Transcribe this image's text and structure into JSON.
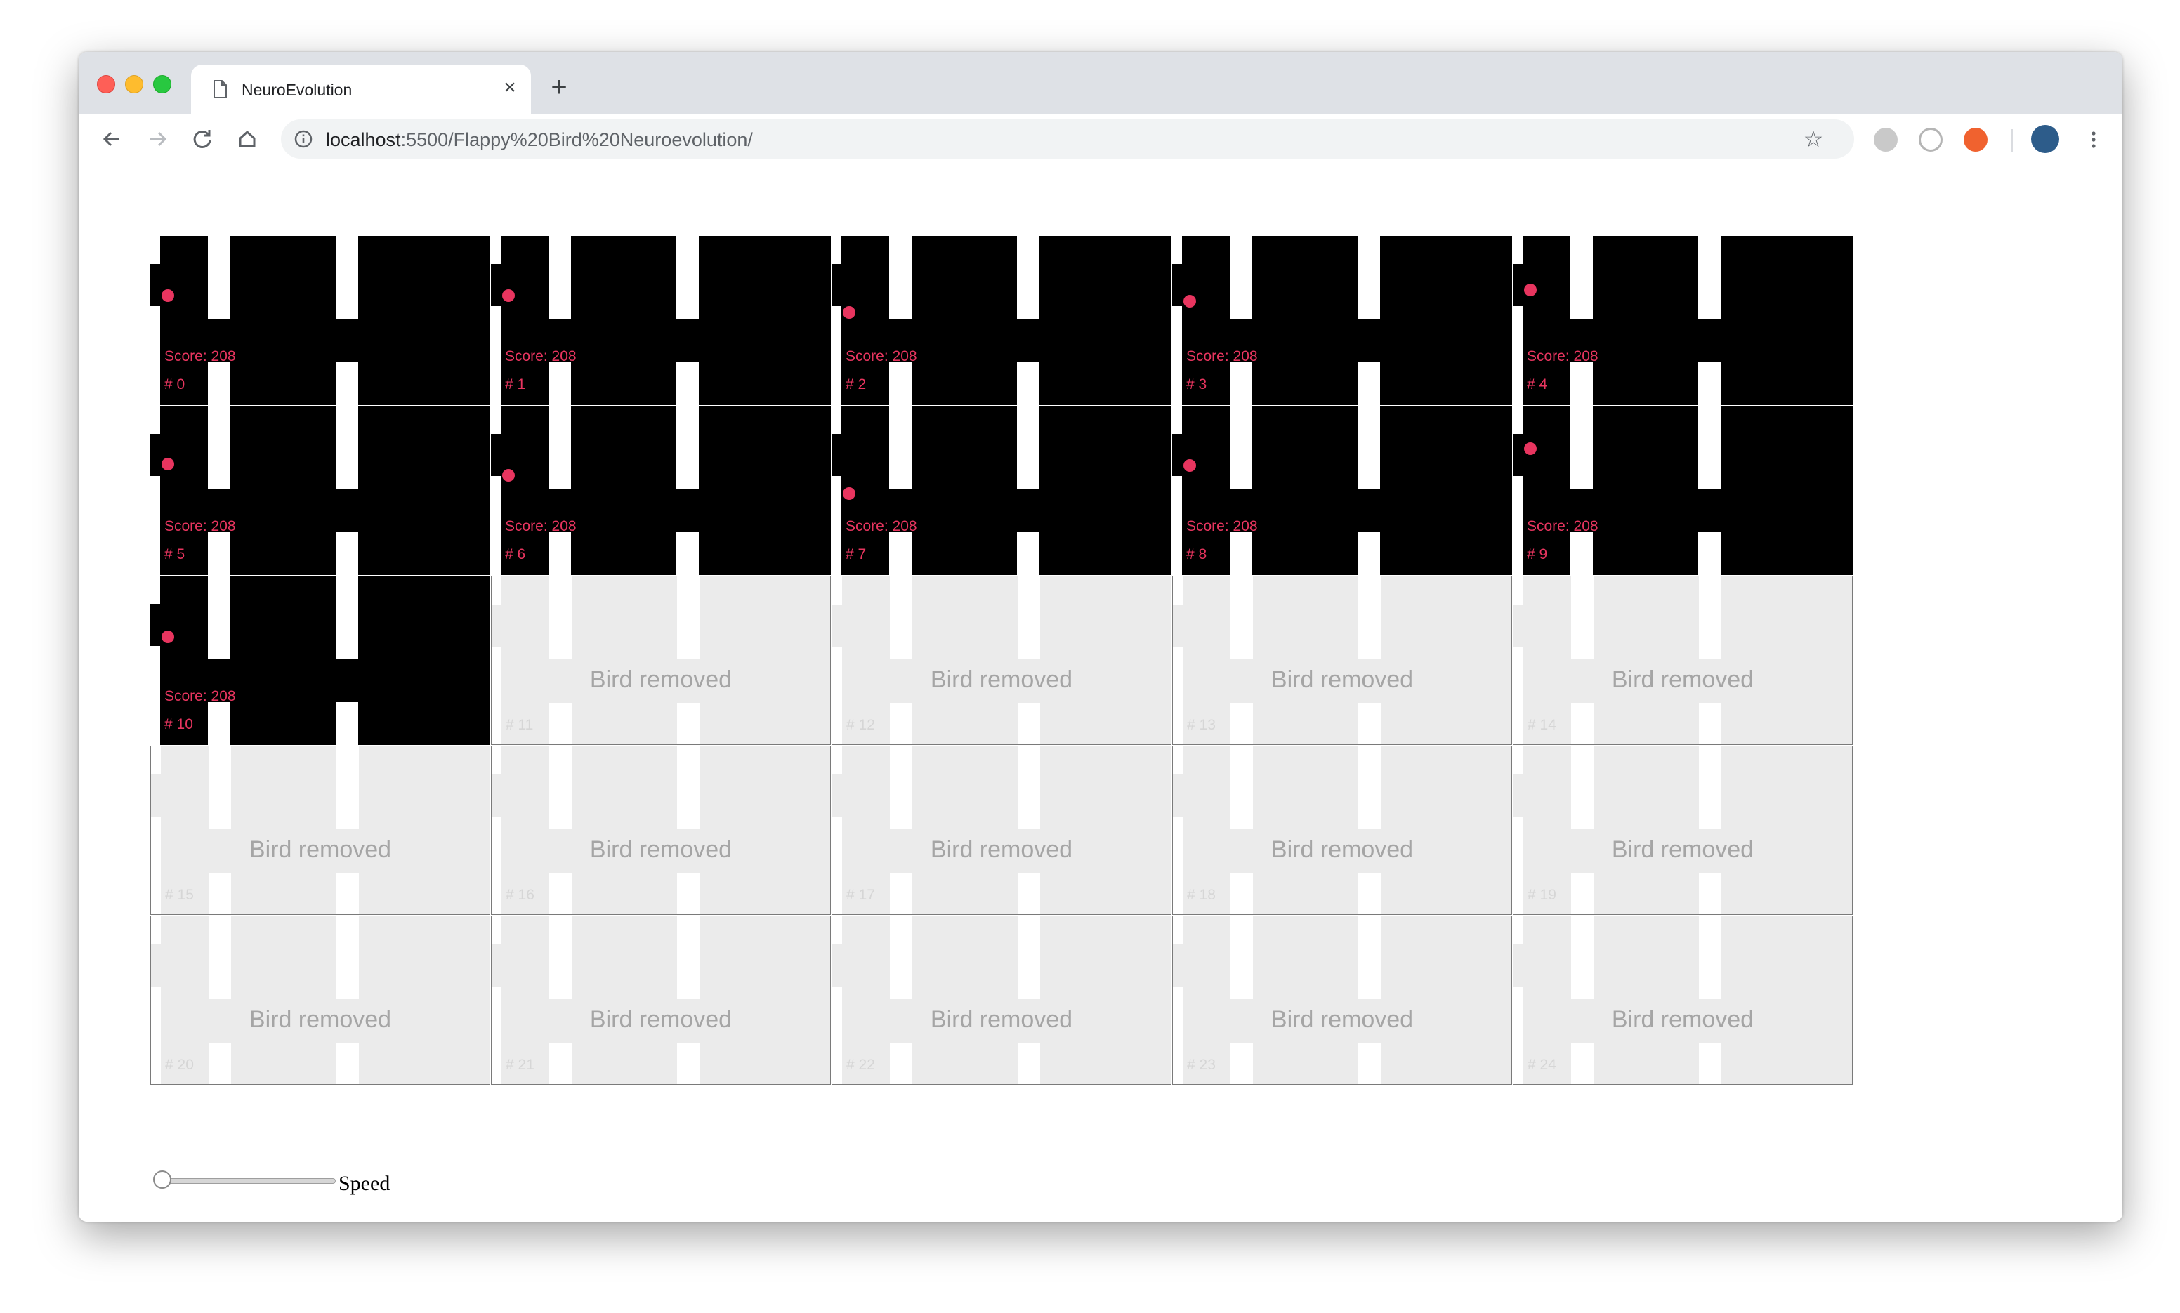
{
  "browser": {
    "tab_title": "NeuroEvolution",
    "tab_close": "×",
    "new_tab": "+",
    "url_host": "localhost",
    "url_rest": ":5500/Flappy%20Bird%20Neuroevolution/",
    "icons": [
      "back-icon",
      "forward-icon",
      "reload-icon",
      "home-icon",
      "info-icon",
      "star-icon",
      "extension-icon",
      "profile-avatar",
      "menu-icon"
    ]
  },
  "game": {
    "score_prefix": "Score: ",
    "index_prefix": "# ",
    "removed_label": "Bird removed",
    "birds": [
      {
        "index": "0",
        "score": "208",
        "alive": true
      },
      {
        "index": "1",
        "score": "208",
        "alive": true
      },
      {
        "index": "2",
        "score": "208",
        "alive": true
      },
      {
        "index": "3",
        "score": "208",
        "alive": true
      },
      {
        "index": "4",
        "score": "208",
        "alive": true
      },
      {
        "index": "5",
        "score": "208",
        "alive": true
      },
      {
        "index": "6",
        "score": "208",
        "alive": true
      },
      {
        "index": "7",
        "score": "208",
        "alive": true
      },
      {
        "index": "8",
        "score": "208",
        "alive": true
      },
      {
        "index": "9",
        "score": "208",
        "alive": true
      },
      {
        "index": "10",
        "score": "208",
        "alive": true
      },
      {
        "index": "11",
        "alive": false
      },
      {
        "index": "12",
        "alive": false
      },
      {
        "index": "13",
        "alive": false
      },
      {
        "index": "14",
        "alive": false
      },
      {
        "index": "15",
        "alive": false
      },
      {
        "index": "16",
        "alive": false
      },
      {
        "index": "17",
        "alive": false
      },
      {
        "index": "18",
        "alive": false
      },
      {
        "index": "19",
        "alive": false
      },
      {
        "index": "20",
        "alive": false
      },
      {
        "index": "21",
        "alive": false
      },
      {
        "index": "22",
        "alive": false
      },
      {
        "index": "23",
        "alive": false
      },
      {
        "index": "24",
        "alive": false
      }
    ],
    "colors": {
      "bird": "#e8355f",
      "alive_bg": "#000000",
      "dead_bg": "#ebebeb",
      "pipe": "#ffffff"
    }
  },
  "controls": {
    "speed_label": "Speed",
    "speed_value": 0
  }
}
